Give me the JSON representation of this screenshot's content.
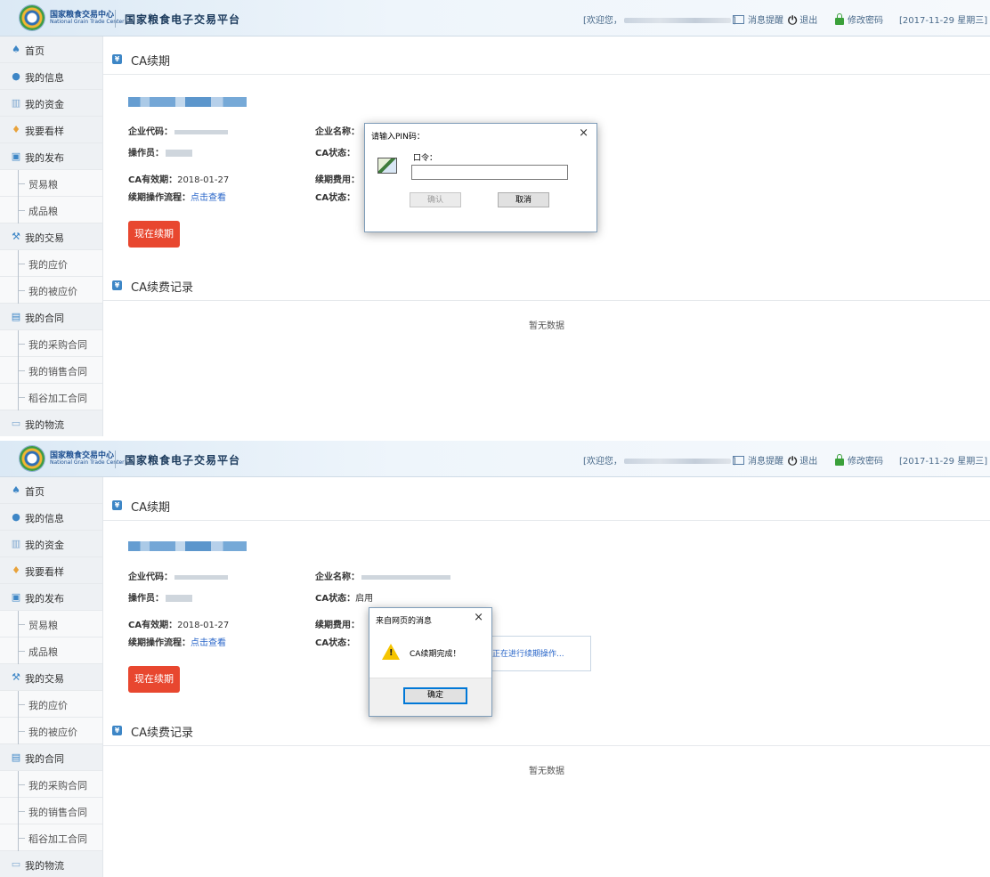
{
  "colors": {
    "accent": "#3d86c6",
    "danger": "#e8472f",
    "link": "#2966c9"
  },
  "header": {
    "logo_cn": "国家粮食交易中心",
    "logo_en": "National Grain Trade Center",
    "platform_title": "国家粮食电子交易平台",
    "welcome": "[欢迎您，",
    "welcome_end": "]",
    "messages": "消息提醒",
    "logout": "退出",
    "change_password": "修改密码",
    "date": "[2017-11-29 星期三]"
  },
  "sidebar": {
    "home": "首页",
    "my_info": "我的信息",
    "my_funds": "我的资金",
    "my_inspection": "我要看样",
    "my_publish": "我的发布",
    "trade_grain": "贸易粮",
    "finished_grain": "成品粮",
    "my_trade": "我的交易",
    "my_bids": "我的应价",
    "my_received_bids": "我的被应价",
    "my_contracts": "我的合同",
    "purchase_contracts": "我的采购合同",
    "sales_contracts": "我的销售合同",
    "rice_contracts": "稻谷加工合同",
    "my_logistics": "我的物流"
  },
  "main": {
    "section_renew": "CA续期",
    "section_records": "CA续费记录",
    "label_company_code": "企业代码：",
    "label_company_name": "企业名称：",
    "label_operator": "操作员：",
    "label_ca_status": "CA状态：",
    "ca_status_value": "启用",
    "label_ca_valid": "CA有效期：",
    "ca_valid_value": "2018-01-27",
    "label_renew_fee": "续期费用：",
    "label_renew_flow": "续期操作流程：",
    "renew_flow_link": "点击查看",
    "renew_button": "现在续期",
    "empty_records": "暂无数据",
    "progress_text": "正在进行续期操作..."
  },
  "pin_dialog": {
    "title": "请输入PIN码：",
    "password_label": "口令：",
    "password_value": "",
    "ok": "确认",
    "cancel": "取消"
  },
  "alert_dialog": {
    "title": "来自网页的消息",
    "message": "CA续期完成！",
    "ok": "确定"
  }
}
